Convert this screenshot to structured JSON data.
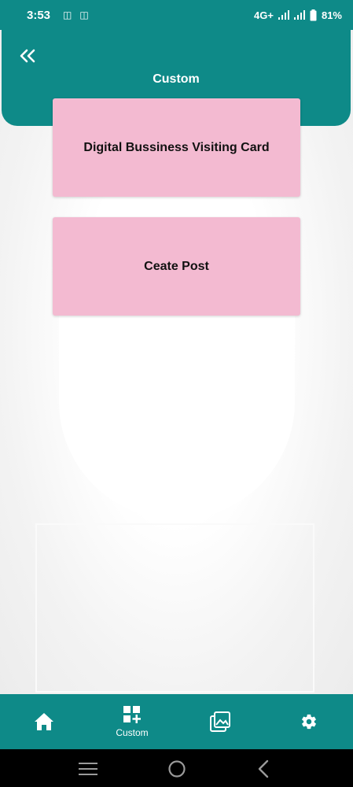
{
  "status_bar": {
    "time": "3:53",
    "network": "4G+",
    "battery": "81%"
  },
  "header": {
    "title": "Custom",
    "back_icon": "double-chevron-left-icon"
  },
  "cards": [
    {
      "label": "Digital Bussiness Visiting Card"
    },
    {
      "label": "Ceate Post"
    }
  ],
  "bottom_nav": {
    "items": [
      {
        "icon": "home-icon",
        "label": ""
      },
      {
        "icon": "grid-plus-icon",
        "label": "Custom"
      },
      {
        "icon": "gallery-icon",
        "label": ""
      },
      {
        "icon": "gear-icon",
        "label": ""
      }
    ]
  },
  "colors": {
    "primary": "#0e8a88",
    "card": "#f3bad1",
    "background": "#f2f2f2"
  }
}
